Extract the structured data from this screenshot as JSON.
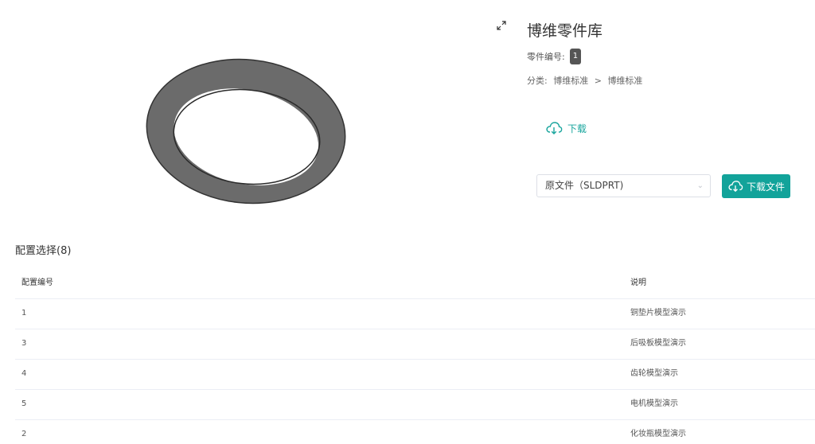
{
  "preview": {
    "expand_icon": "expand-icon"
  },
  "info": {
    "title": "博维零件库",
    "part_no_label": "零件编号:",
    "part_no_value": "1",
    "category_label": "分类:",
    "category_path": [
      "博维标准",
      ">",
      "博维标准"
    ]
  },
  "download": {
    "link_label": "下载",
    "link_icon": "cloud-download-icon",
    "format_selected": "原文件（SLDPRT)",
    "button_label": "下载文件",
    "accent_color": "#12a39a"
  },
  "config": {
    "title": "配置选择(8)",
    "columns": [
      "配置编号",
      "说明"
    ],
    "rows": [
      {
        "id": "1",
        "desc": "铜垫片模型演示"
      },
      {
        "id": "3",
        "desc": "后吸板模型演示"
      },
      {
        "id": "4",
        "desc": "齿轮模型演示"
      },
      {
        "id": "5",
        "desc": "电机模型演示"
      },
      {
        "id": "2",
        "desc": "化妆瓶模型演示"
      }
    ]
  }
}
